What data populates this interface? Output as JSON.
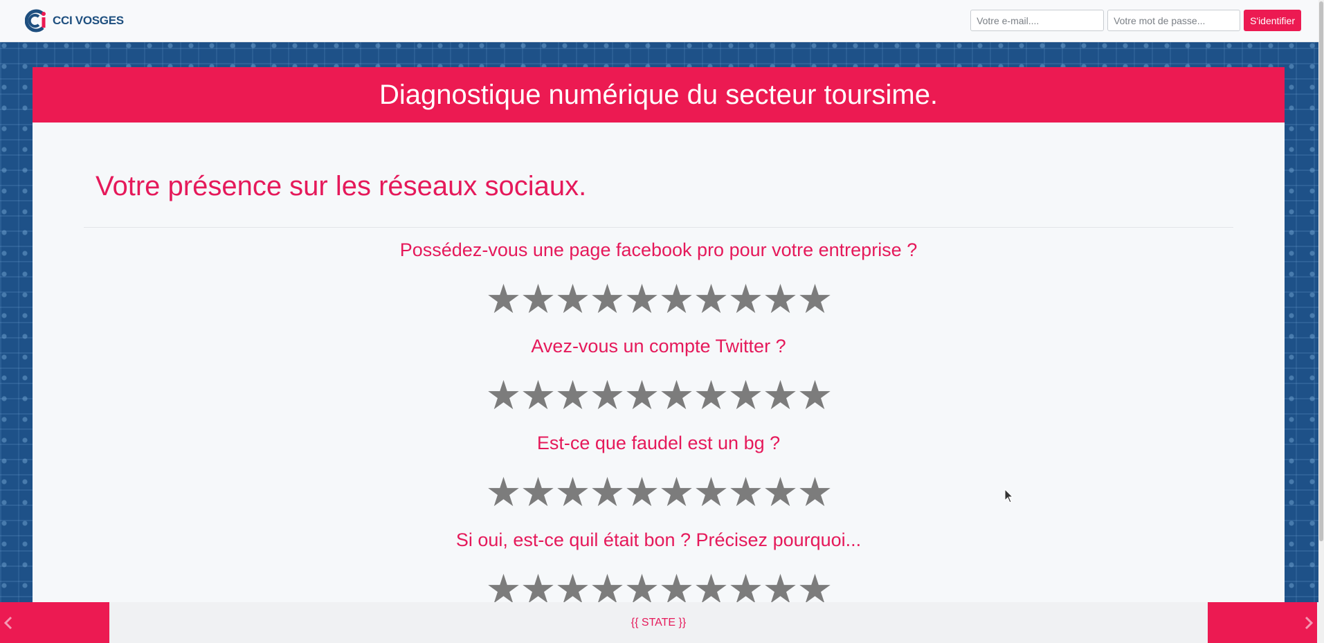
{
  "header": {
    "logo_text": "CCI VOSGES",
    "email_placeholder": "Votre e-mail....",
    "password_placeholder": "Votre mot de passe...",
    "login_button": "S'identifier"
  },
  "card": {
    "title": "Diagnostique numérique du secteur toursime.",
    "section_title": "Votre présence sur les réseaux sociaux.",
    "questions": [
      {
        "label": "Possédez-vous une page facebook pro pour votre entreprise ?",
        "stars": 10
      },
      {
        "label": "Avez-vous un compte Twitter ?",
        "stars": 10
      },
      {
        "label": "Est-ce que faudel est un bg ?",
        "stars": 10
      },
      {
        "label": "Si oui, est-ce quil était bon ? Précisez pourquoi...",
        "stars": 10
      }
    ]
  },
  "footer": {
    "state_text": "{{ STATE }}"
  },
  "colors": {
    "accent": "#ec1a52",
    "star": "#7c7c7c",
    "background": "#1e5188"
  }
}
